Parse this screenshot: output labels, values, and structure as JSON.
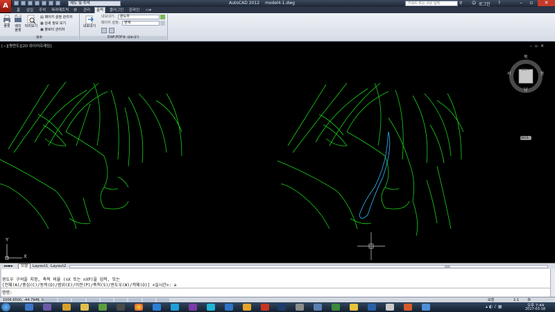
{
  "titlebar": {
    "app_title": "AutoCAD 2012",
    "file_name": "model4-1.dwg",
    "workspace": "제도 및 주석",
    "search_placeholder": "키워드 또는 구문 입력",
    "user_label": "로그인"
  },
  "app_button": {
    "label": "A"
  },
  "tabs": [
    "홈",
    "삽입",
    "주석",
    "파라메트릭",
    "뷰",
    "관리",
    "출력",
    "플러그인",
    "온라인"
  ],
  "active_tab_index": 6,
  "ribbon": {
    "plot_button": "플롯",
    "batch_plot_line1": "배치",
    "batch_plot_line2": "플롯",
    "preview_button": "미리보기",
    "page_setup_manager": "페이지 설정 관리자",
    "plot_details": "상세 정보 보기",
    "plotter_manager": "플로터 관리자",
    "export_button": "내보내기",
    "export_label": "내보내기:",
    "export_value": "윈도우",
    "page_setup_label": "페이지 설정:",
    "page_setup_value": "현재",
    "panel_plot": "플롯",
    "panel_export": "DWF/PDF로 내보내기"
  },
  "viewport": {
    "label": "[−][평면도][2D 와이어프레임]",
    "viewcube_center": "평면도",
    "viewcube_n": "북",
    "viewcube_s": "남",
    "viewcube_w": "서",
    "viewcube_e": "동",
    "ucs_label": "WCS",
    "axis_x": "X",
    "axis_y": "Y"
  },
  "layout_tabs": [
    "모형",
    "Layout1",
    "Layout2"
  ],
  "command": {
    "line1": "윈도우 구석을 지정, 축척 비율 (nX 또는 nXP)을 입력, 또는",
    "line2": "[전체(A)/중심(C)/동적(D)/범위(E)/이전(P)/축척(S)/윈도우(W)/객체(O)] <실시간>: a",
    "prompt": "명령:"
  },
  "status": {
    "coords": "1006.6500, -44.7946, 0.0000",
    "model_label": "모형",
    "scale": "1:1"
  },
  "taskbar": {
    "time": "오후 7:44",
    "date": "2017-03-18"
  },
  "colors": {
    "drawing_lines": "#19d219",
    "highlight_lines": "#2ea6e0",
    "canvas": "#000000"
  }
}
